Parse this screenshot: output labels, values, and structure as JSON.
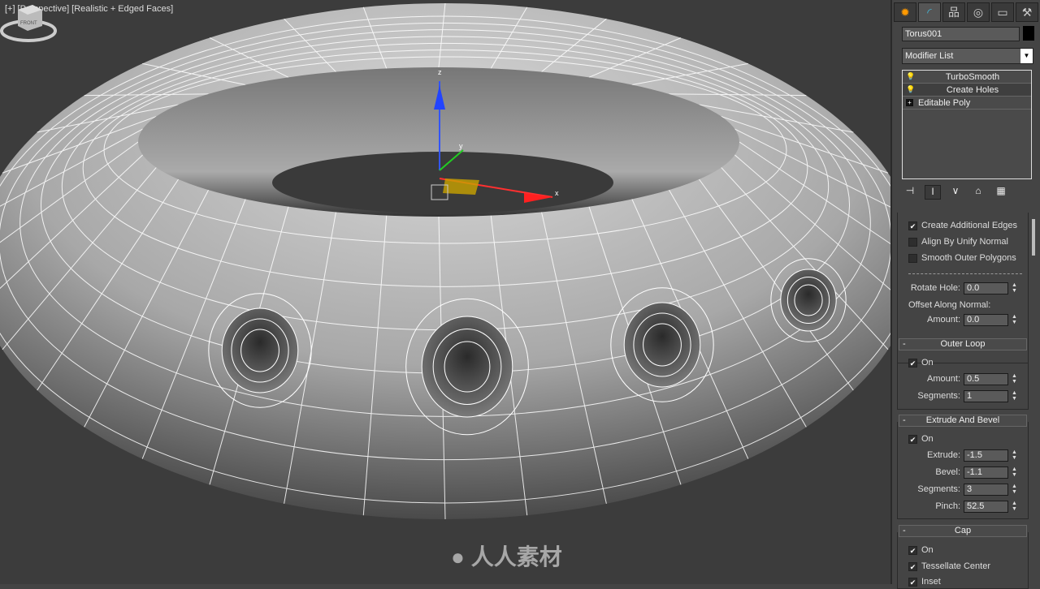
{
  "viewport": {
    "labels": [
      "[+]",
      "[Perspective]",
      "[Realistic + Edged Faces]"
    ],
    "viewcube_label": "FRONT",
    "axis": {
      "x": "x",
      "y": "y",
      "z": "z"
    },
    "watermark": "人人素材"
  },
  "panel": {
    "tabs": [
      {
        "icon": "create-icon",
        "glyph": "✹"
      },
      {
        "icon": "modify-icon",
        "glyph": "◜"
      },
      {
        "icon": "hierarchy-icon",
        "glyph": "品"
      },
      {
        "icon": "motion-icon",
        "glyph": "◎"
      },
      {
        "icon": "display-icon",
        "glyph": "▭"
      },
      {
        "icon": "utilities-icon",
        "glyph": "⚒"
      }
    ],
    "object_name": "Torus001",
    "object_color": "#000000",
    "modifier_list": "Modifier List",
    "stack": [
      {
        "label": "TurboSmooth",
        "icon": "bulb-icon"
      },
      {
        "label": "Create Holes",
        "icon": "bulb-icon"
      },
      {
        "label": "Editable Poly",
        "icon": "expand-icon"
      }
    ],
    "options": [
      {
        "label": "Create Additional Edges",
        "checked": true
      },
      {
        "label": "Align By Unify Normal",
        "checked": false
      },
      {
        "label": "Smooth Outer Polygons",
        "checked": false
      }
    ],
    "rotate_hole": {
      "label": "Rotate Hole:",
      "value": "0.0"
    },
    "offset_label": "Offset Along Normal:",
    "offset_amount": {
      "label": "Amount:",
      "value": "0.0"
    },
    "outer_loop": {
      "title": "Outer Loop",
      "collapse": "-",
      "on": {
        "label": "On",
        "checked": true
      },
      "amount": {
        "label": "Amount:",
        "value": "0.5"
      },
      "segments": {
        "label": "Segments:",
        "value": "1"
      }
    },
    "extrude_bevel": {
      "title": "Extrude And Bevel",
      "collapse": "-",
      "on": {
        "label": "On",
        "checked": true
      },
      "extrude": {
        "label": "Extrude:",
        "value": "-1.5"
      },
      "bevel": {
        "label": "Bevel:",
        "value": "-1.1"
      },
      "segments": {
        "label": "Segments:",
        "value": "3"
      },
      "pinch": {
        "label": "Pinch:",
        "value": "52.5"
      }
    },
    "cap": {
      "title": "Cap",
      "collapse": "-",
      "on": {
        "label": "On",
        "checked": true
      },
      "tessellate": {
        "label": "Tessellate Center",
        "checked": true
      },
      "inset": {
        "label": "Inset",
        "checked": true
      }
    }
  }
}
